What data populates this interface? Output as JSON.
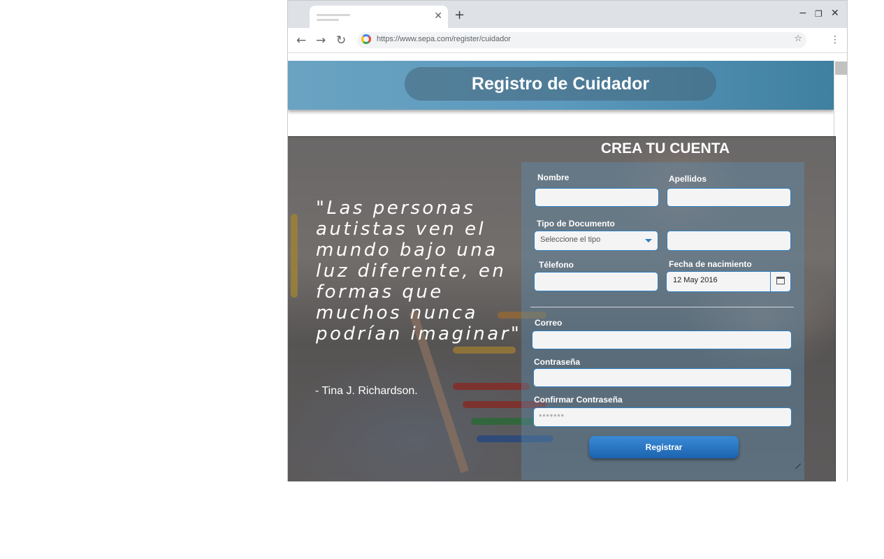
{
  "browser": {
    "tab_close_glyph": "✕",
    "new_tab_glyph": "+",
    "minimize_glyph": "−",
    "restore_glyph": "❐",
    "close_glyph": "✕",
    "back_glyph": "←",
    "forward_glyph": "→",
    "reload_glyph": "↻",
    "url": "https://www.sepa.com/register/cuidador",
    "star_glyph": "☆",
    "menu_glyph": "⋮"
  },
  "header": {
    "title": "Registro de Cuidador"
  },
  "hero": {
    "quote": "\"Las personas autistas ven el mundo bajo una luz diferente, en formas que muchos nunca podrían imaginar\"",
    "author": "- Tina J. Richardson."
  },
  "form": {
    "title": "CREA TU CUENTA",
    "nombre_label": "Nombre",
    "nombre_value": "",
    "apellidos_label": "Apellidos",
    "apellidos_value": "",
    "tipo_documento_label": "Tipo de Documento",
    "tipo_documento_selected": "Seleccione el tipo",
    "documento_value": "",
    "telefono_label": "Télefono",
    "telefono_value": "",
    "fecha_label": "Fecha de nacimiento",
    "fecha_value": "12 May 2016",
    "correo_label": "Correo",
    "correo_value": "",
    "contrasena_label": "Contraseña",
    "contrasena_value": "",
    "confirmar_label": "Confirmar Contraseña",
    "confirmar_masked": "*******",
    "submit_label": "Registrar"
  },
  "colors": {
    "accent": "#2f7fc1",
    "header_band": "#5b99bd",
    "button": "#1c63ae"
  },
  "icons": [
    "google-icon",
    "star-icon",
    "kebab-menu-icon",
    "calendar-icon",
    "dropdown-caret-icon"
  ]
}
